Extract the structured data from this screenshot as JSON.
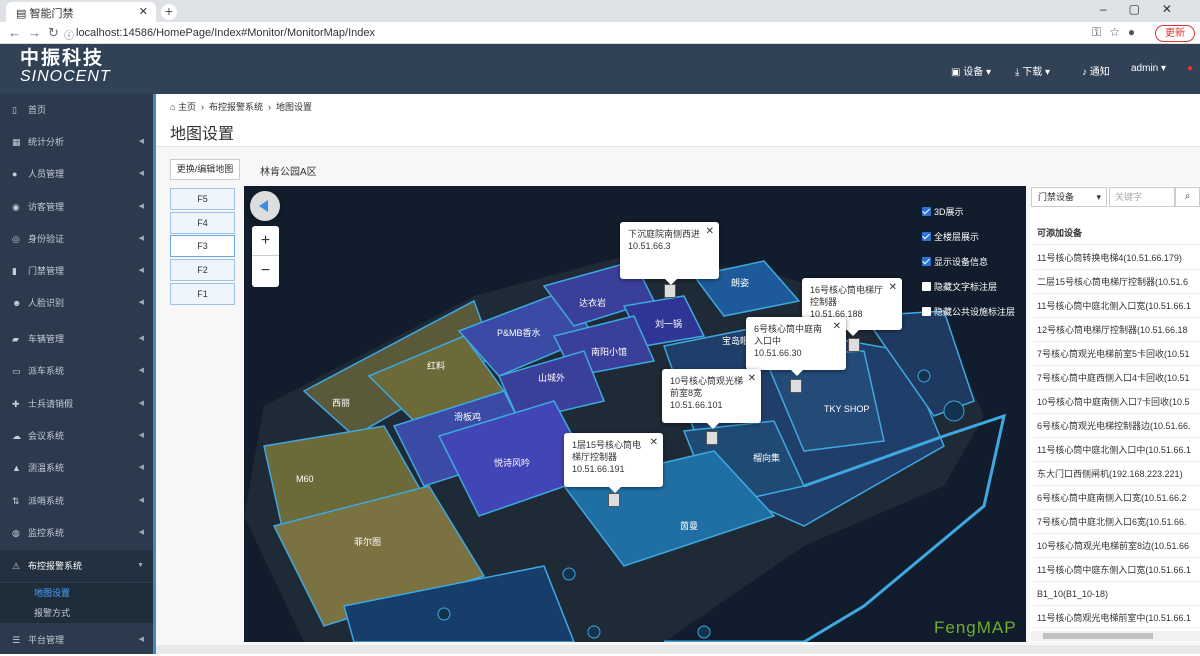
{
  "browser": {
    "active_tab_title": "智能门禁",
    "background_tab_title": "",
    "url": "localhost:14586/HomePage/Index#Monitor/MonitorMap/Index",
    "update_label": "更新"
  },
  "header": {
    "logo_cn": "中振科技",
    "logo_en": "SINOCENT",
    "device_label": "设备",
    "download_label": "下载",
    "notice_label": "通知",
    "user_label": "admin"
  },
  "sidebar": {
    "items": [
      {
        "label": "首页"
      },
      {
        "label": "统计分析"
      },
      {
        "label": "人员管理"
      },
      {
        "label": "访客管理"
      },
      {
        "label": "身份验证"
      },
      {
        "label": "门禁管理"
      },
      {
        "label": "人脸识别"
      },
      {
        "label": "车辆管理"
      },
      {
        "label": "派车系统"
      },
      {
        "label": "士兵请销假"
      },
      {
        "label": "会议系统"
      },
      {
        "label": "测温系统"
      },
      {
        "label": "派哨系统"
      },
      {
        "label": "监控系统"
      },
      {
        "label": "布控报警系统"
      },
      {
        "label": "平台管理"
      }
    ],
    "subitems": [
      {
        "label": "地图设置"
      },
      {
        "label": "报警方式"
      }
    ]
  },
  "breadcrumb": {
    "home": "主页",
    "section": "布控报警系统",
    "page": "地图设置"
  },
  "page_title": "地图设置",
  "toolbar": {
    "edit_map_label": "更换/编辑地图",
    "area_title": "林肯公园A区"
  },
  "floors": [
    "F5",
    "F4",
    "F3",
    "F2",
    "F1"
  ],
  "map": {
    "options": [
      {
        "label": "3D展示",
        "checked": true
      },
      {
        "label": "全楼层展示",
        "checked": true
      },
      {
        "label": "显示设备信息",
        "checked": true
      },
      {
        "label": "隐藏文字标注层",
        "checked": false
      },
      {
        "label": "隐藏公共设施标注层",
        "checked": false
      }
    ],
    "shop_labels": [
      "西丽",
      "红料",
      "P&MB香水",
      "达衣岩",
      "刘一锅",
      "朗姿",
      "南阳小馆",
      "宝岛眼",
      "山城外",
      "滑板鸡",
      "悦诗风吟",
      "TKY SHOP",
      "榴向集",
      "M60",
      "茵曼",
      "菲尔图"
    ],
    "popups": [
      {
        "name": "下沉庭院南侧西进",
        "ip": "10.51.66.3"
      },
      {
        "name": "16号核心筒电梯厅控制器",
        "ip": "10.51.66.188"
      },
      {
        "name": "6号核心筒中庭南入口中",
        "ip": "10.51.66.30"
      },
      {
        "name": "10号核心筒观光梯前室8宽",
        "ip": "10.51.66.101"
      },
      {
        "name": "1层15号核心筒电梯厅控制器",
        "ip": "10.51.66.191"
      }
    ],
    "watermark": "FengMAP"
  },
  "device_panel": {
    "type_select": "门禁设备",
    "keyword_placeholder": "关键字",
    "header": "可添加设备",
    "devices": [
      "11号核心筒转换电梯4(10.51.66.179)",
      "二层15号核心筒电梯厅控制器(10.51.6",
      "11号核心筒中庭北侧入口宽(10.51.66.1",
      "12号核心筒电梯厅控制器(10.51.66.18",
      "7号核心筒观光电梯前室5卡回收(10.51",
      "7号核心筒中庭西侧入口4卡回收(10.51",
      "10号核心筒中庭南侧入口7卡回收(10.5",
      "6号核心筒观光电梯控制器边(10.51.66.",
      "11号核心筒中庭北侧入口中(10.51.66.1",
      "东大门口西侧闸机(192.168.223.221)",
      "6号核心筒中庭南侧入口宽(10.51.66.2",
      "7号核心筒中庭北侧入口6宽(10.51.66.",
      "10号核心筒观光电梯前室8边(10.51.66",
      "11号核心筒中庭东侧入口宽(10.51.66.1",
      "B1_10(B1_10-18)",
      "11号核心筒观光电梯前室中(10.51.66.1"
    ]
  },
  "colors": {
    "topbar": "#314156",
    "sidebar": "#2b3a4c",
    "accent": "#3c8dbc",
    "map_bg": "#111d2c"
  }
}
